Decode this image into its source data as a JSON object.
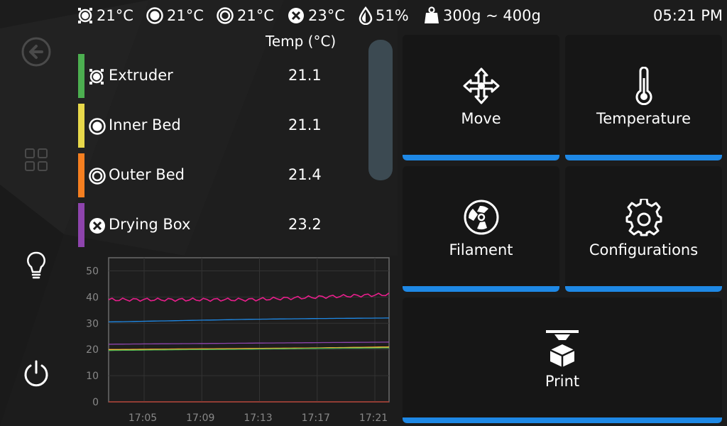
{
  "status": {
    "extruder_temp": "21°C",
    "inner_bed_temp": "21°C",
    "outer_bed_temp": "21°C",
    "drying_box_temp": "23°C",
    "humidity": "51%",
    "filament_weight": "300g ~ 400g",
    "time": "05:21 PM"
  },
  "nav": {
    "icons": [
      "back-arrow-icon",
      "grid-icon",
      "lightbulb-icon",
      "power-icon"
    ]
  },
  "temps": {
    "header": "Temp (°C)",
    "rows": [
      {
        "name": "Extruder",
        "value": "21.1",
        "color": "#4caf50",
        "icon": "extruder-icon"
      },
      {
        "name": "Inner Bed",
        "value": "21.1",
        "color": "#e8d84a",
        "icon": "inner-bed-icon"
      },
      {
        "name": "Outer Bed",
        "value": "21.4",
        "color": "#f57f20",
        "icon": "outer-bed-icon"
      },
      {
        "name": "Drying Box",
        "value": "23.2",
        "color": "#8e44ad",
        "icon": "drying-box-icon"
      }
    ]
  },
  "chart_data": {
    "type": "line",
    "x": [
      "17:05",
      "17:09",
      "17:13",
      "17:17",
      "17:21"
    ],
    "ylim": [
      0,
      55
    ],
    "yticks": [
      "50",
      "40",
      "30",
      "20",
      "10",
      "0"
    ],
    "grid": true,
    "series": [
      {
        "color": "#e91e8c",
        "values": [
          39,
          39,
          39,
          40,
          41
        ]
      },
      {
        "color": "#1e88e5",
        "values": [
          30.5,
          31,
          31.5,
          31.8,
          32
        ]
      },
      {
        "color": "#8e44ad",
        "values": [
          22,
          22.2,
          22.4,
          22.6,
          22.8
        ]
      },
      {
        "color": "#f57f20",
        "values": [
          20,
          20.2,
          20.4,
          20.6,
          21
        ]
      },
      {
        "color": "#e8d84a",
        "values": [
          19.8,
          20,
          20.2,
          20.5,
          20.8
        ]
      },
      {
        "color": "#4caf50",
        "values": [
          19.6,
          19.9,
          20.1,
          20.4,
          20.6
        ]
      },
      {
        "color": "#c0392b",
        "values": [
          0,
          0,
          0,
          0,
          0
        ]
      }
    ]
  },
  "tiles": {
    "move": "Move",
    "temperature": "Temperature",
    "filament": "Filament",
    "configurations": "Configurations",
    "print": "Print"
  },
  "accent_color": "#1e88e5"
}
